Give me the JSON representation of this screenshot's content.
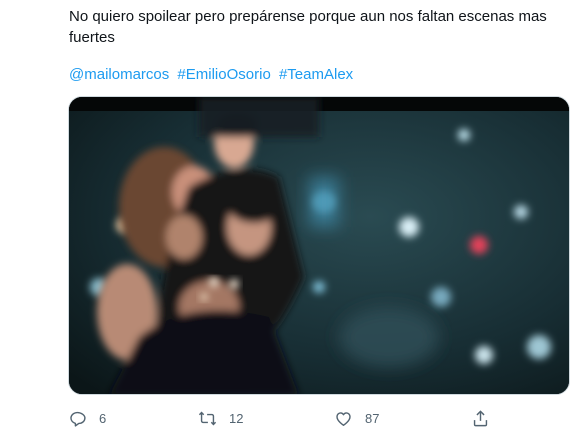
{
  "tweet": {
    "text": "No quiero spoilear pero prepárense porque aun nos faltan escenas mas fuertes",
    "tags": [
      "@mailomarcos",
      "#EmilioOsorio",
      "#TeamAlex"
    ]
  },
  "actions": {
    "reply_count": "6",
    "retweet_count": "12",
    "like_count": "87"
  },
  "colors": {
    "link": "#1d9bf0",
    "icon": "#536471",
    "text": "#0f1419"
  },
  "icons": [
    "reply-icon",
    "retweet-icon",
    "like-icon",
    "share-icon"
  ]
}
